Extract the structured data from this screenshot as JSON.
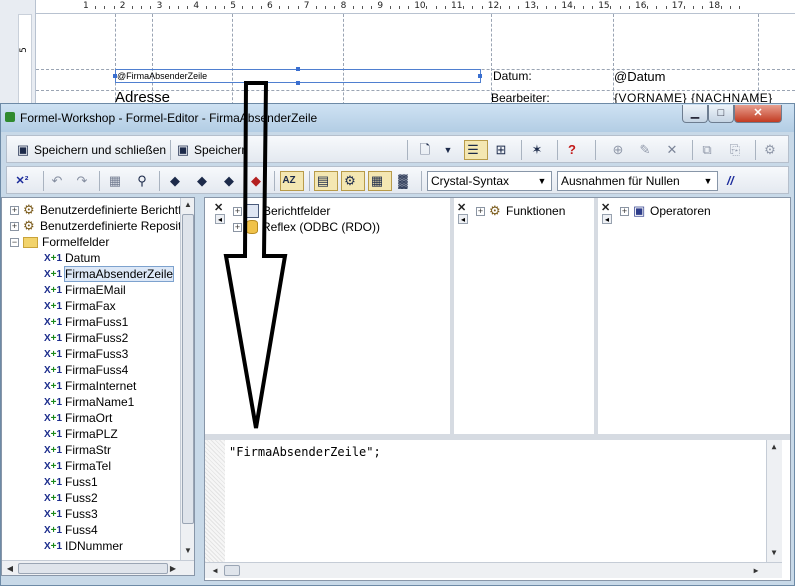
{
  "report": {
    "ruler_numbers": [
      "1",
      "2",
      "3",
      "4",
      "5",
      "6",
      "7",
      "8",
      "9",
      "10",
      "11",
      "12",
      "13",
      "14",
      "15",
      "16",
      "17",
      "18"
    ],
    "vruler_label": "5",
    "field_firma": "@FirmaAbsenderZeile",
    "label_datum": "Datum:",
    "field_datum": "@Datum",
    "label_adresse": "Adresse",
    "label_bearbeiter": "Bearbeiter:",
    "field_name": "{VORNAME} {NACHNAME}"
  },
  "window": {
    "title": "Formel-Workshop - Formel-Editor - FirmaAbsenderZeile",
    "minimize_icon": "minimize-icon",
    "maximize_icon": "maximize-icon",
    "close_icon": "close-icon"
  },
  "toolbar1": {
    "save_close": "Speichern und schließen",
    "save": "Speichern"
  },
  "toolbar2": {
    "syntax": "Crystal-Syntax",
    "nulls": "Ausnahmen für Nullen",
    "comment": "//"
  },
  "tree": {
    "items": [
      {
        "label": "Benutzerdefinierte Berichtfun",
        "kind": "gear"
      },
      {
        "label": "Benutzerdefinierte Repositor",
        "kind": "gear"
      },
      {
        "label": "Formelfelder",
        "kind": "folder"
      },
      {
        "label": "Datum",
        "kind": "formula"
      },
      {
        "label": "FirmaAbsenderZeile",
        "kind": "formula",
        "selected": true
      },
      {
        "label": "FirmaEMail",
        "kind": "formula"
      },
      {
        "label": "FirmaFax",
        "kind": "formula"
      },
      {
        "label": "FirmaFuss1",
        "kind": "formula"
      },
      {
        "label": "FirmaFuss2",
        "kind": "formula"
      },
      {
        "label": "FirmaFuss3",
        "kind": "formula"
      },
      {
        "label": "FirmaFuss4",
        "kind": "formula"
      },
      {
        "label": "FirmaInternet",
        "kind": "formula"
      },
      {
        "label": "FirmaName1",
        "kind": "formula"
      },
      {
        "label": "FirmaOrt",
        "kind": "formula"
      },
      {
        "label": "FirmaPLZ",
        "kind": "formula"
      },
      {
        "label": "FirmaStr",
        "kind": "formula"
      },
      {
        "label": "FirmaTel",
        "kind": "formula"
      },
      {
        "label": "Fuss1",
        "kind": "formula"
      },
      {
        "label": "Fuss2",
        "kind": "formula"
      },
      {
        "label": "Fuss3",
        "kind": "formula"
      },
      {
        "label": "Fuss4",
        "kind": "formula"
      },
      {
        "label": "IDNummer",
        "kind": "formula"
      }
    ]
  },
  "panes": {
    "fields": [
      "Berichtfelder",
      "Reflex (ODBC (RDO))"
    ],
    "functions": "Funktionen",
    "operators": "Operatoren"
  },
  "editor": {
    "code": "\"FirmaAbsenderZeile\";"
  },
  "colors": {
    "window_frame": "#c8d9e8",
    "selection": "#4f7fd0",
    "selected_item": "#dde8f7"
  }
}
